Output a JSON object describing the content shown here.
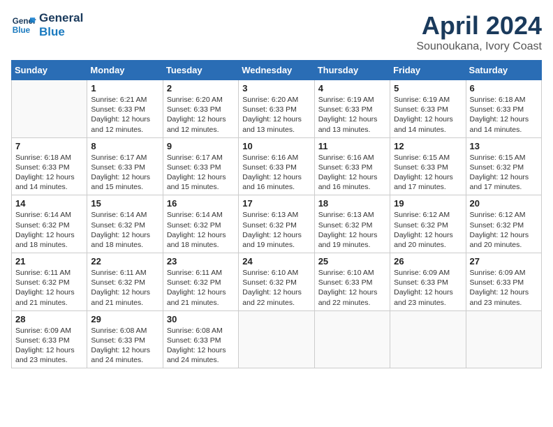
{
  "header": {
    "logo_line1": "General",
    "logo_line2": "Blue",
    "month_title": "April 2024",
    "location": "Sounoukana, Ivory Coast"
  },
  "weekdays": [
    "Sunday",
    "Monday",
    "Tuesday",
    "Wednesday",
    "Thursday",
    "Friday",
    "Saturday"
  ],
  "weeks": [
    [
      {
        "day": "",
        "sunrise": "",
        "sunset": "",
        "daylight": ""
      },
      {
        "day": "1",
        "sunrise": "Sunrise: 6:21 AM",
        "sunset": "Sunset: 6:33 PM",
        "daylight": "Daylight: 12 hours and 12 minutes."
      },
      {
        "day": "2",
        "sunrise": "Sunrise: 6:20 AM",
        "sunset": "Sunset: 6:33 PM",
        "daylight": "Daylight: 12 hours and 12 minutes."
      },
      {
        "day": "3",
        "sunrise": "Sunrise: 6:20 AM",
        "sunset": "Sunset: 6:33 PM",
        "daylight": "Daylight: 12 hours and 13 minutes."
      },
      {
        "day": "4",
        "sunrise": "Sunrise: 6:19 AM",
        "sunset": "Sunset: 6:33 PM",
        "daylight": "Daylight: 12 hours and 13 minutes."
      },
      {
        "day": "5",
        "sunrise": "Sunrise: 6:19 AM",
        "sunset": "Sunset: 6:33 PM",
        "daylight": "Daylight: 12 hours and 14 minutes."
      },
      {
        "day": "6",
        "sunrise": "Sunrise: 6:18 AM",
        "sunset": "Sunset: 6:33 PM",
        "daylight": "Daylight: 12 hours and 14 minutes."
      }
    ],
    [
      {
        "day": "7",
        "sunrise": "Sunrise: 6:18 AM",
        "sunset": "Sunset: 6:33 PM",
        "daylight": "Daylight: 12 hours and 14 minutes."
      },
      {
        "day": "8",
        "sunrise": "Sunrise: 6:17 AM",
        "sunset": "Sunset: 6:33 PM",
        "daylight": "Daylight: 12 hours and 15 minutes."
      },
      {
        "day": "9",
        "sunrise": "Sunrise: 6:17 AM",
        "sunset": "Sunset: 6:33 PM",
        "daylight": "Daylight: 12 hours and 15 minutes."
      },
      {
        "day": "10",
        "sunrise": "Sunrise: 6:16 AM",
        "sunset": "Sunset: 6:33 PM",
        "daylight": "Daylight: 12 hours and 16 minutes."
      },
      {
        "day": "11",
        "sunrise": "Sunrise: 6:16 AM",
        "sunset": "Sunset: 6:33 PM",
        "daylight": "Daylight: 12 hours and 16 minutes."
      },
      {
        "day": "12",
        "sunrise": "Sunrise: 6:15 AM",
        "sunset": "Sunset: 6:33 PM",
        "daylight": "Daylight: 12 hours and 17 minutes."
      },
      {
        "day": "13",
        "sunrise": "Sunrise: 6:15 AM",
        "sunset": "Sunset: 6:32 PM",
        "daylight": "Daylight: 12 hours and 17 minutes."
      }
    ],
    [
      {
        "day": "14",
        "sunrise": "Sunrise: 6:14 AM",
        "sunset": "Sunset: 6:32 PM",
        "daylight": "Daylight: 12 hours and 18 minutes."
      },
      {
        "day": "15",
        "sunrise": "Sunrise: 6:14 AM",
        "sunset": "Sunset: 6:32 PM",
        "daylight": "Daylight: 12 hours and 18 minutes."
      },
      {
        "day": "16",
        "sunrise": "Sunrise: 6:14 AM",
        "sunset": "Sunset: 6:32 PM",
        "daylight": "Daylight: 12 hours and 18 minutes."
      },
      {
        "day": "17",
        "sunrise": "Sunrise: 6:13 AM",
        "sunset": "Sunset: 6:32 PM",
        "daylight": "Daylight: 12 hours and 19 minutes."
      },
      {
        "day": "18",
        "sunrise": "Sunrise: 6:13 AM",
        "sunset": "Sunset: 6:32 PM",
        "daylight": "Daylight: 12 hours and 19 minutes."
      },
      {
        "day": "19",
        "sunrise": "Sunrise: 6:12 AM",
        "sunset": "Sunset: 6:32 PM",
        "daylight": "Daylight: 12 hours and 20 minutes."
      },
      {
        "day": "20",
        "sunrise": "Sunrise: 6:12 AM",
        "sunset": "Sunset: 6:32 PM",
        "daylight": "Daylight: 12 hours and 20 minutes."
      }
    ],
    [
      {
        "day": "21",
        "sunrise": "Sunrise: 6:11 AM",
        "sunset": "Sunset: 6:32 PM",
        "daylight": "Daylight: 12 hours and 21 minutes."
      },
      {
        "day": "22",
        "sunrise": "Sunrise: 6:11 AM",
        "sunset": "Sunset: 6:32 PM",
        "daylight": "Daylight: 12 hours and 21 minutes."
      },
      {
        "day": "23",
        "sunrise": "Sunrise: 6:11 AM",
        "sunset": "Sunset: 6:32 PM",
        "daylight": "Daylight: 12 hours and 21 minutes."
      },
      {
        "day": "24",
        "sunrise": "Sunrise: 6:10 AM",
        "sunset": "Sunset: 6:32 PM",
        "daylight": "Daylight: 12 hours and 22 minutes."
      },
      {
        "day": "25",
        "sunrise": "Sunrise: 6:10 AM",
        "sunset": "Sunset: 6:33 PM",
        "daylight": "Daylight: 12 hours and 22 minutes."
      },
      {
        "day": "26",
        "sunrise": "Sunrise: 6:09 AM",
        "sunset": "Sunset: 6:33 PM",
        "daylight": "Daylight: 12 hours and 23 minutes."
      },
      {
        "day": "27",
        "sunrise": "Sunrise: 6:09 AM",
        "sunset": "Sunset: 6:33 PM",
        "daylight": "Daylight: 12 hours and 23 minutes."
      }
    ],
    [
      {
        "day": "28",
        "sunrise": "Sunrise: 6:09 AM",
        "sunset": "Sunset: 6:33 PM",
        "daylight": "Daylight: 12 hours and 23 minutes."
      },
      {
        "day": "29",
        "sunrise": "Sunrise: 6:08 AM",
        "sunset": "Sunset: 6:33 PM",
        "daylight": "Daylight: 12 hours and 24 minutes."
      },
      {
        "day": "30",
        "sunrise": "Sunrise: 6:08 AM",
        "sunset": "Sunset: 6:33 PM",
        "daylight": "Daylight: 12 hours and 24 minutes."
      },
      {
        "day": "",
        "sunrise": "",
        "sunset": "",
        "daylight": ""
      },
      {
        "day": "",
        "sunrise": "",
        "sunset": "",
        "daylight": ""
      },
      {
        "day": "",
        "sunrise": "",
        "sunset": "",
        "daylight": ""
      },
      {
        "day": "",
        "sunrise": "",
        "sunset": "",
        "daylight": ""
      }
    ]
  ]
}
